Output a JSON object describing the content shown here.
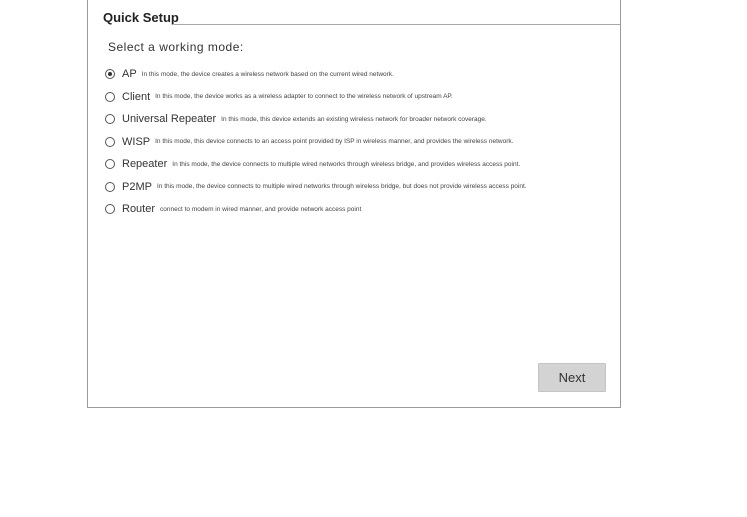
{
  "quick_setup": {
    "legend": "Quick Setup",
    "prompt": "Select a working mode:"
  },
  "modes": [
    {
      "name": "AP",
      "description": "In this mode, the device creates a wireless network based on the current wired network.",
      "selected": true
    },
    {
      "name": "Client",
      "description": "In this mode, the device works as a wireless adapter to connect to the wireless network of upstream AP.",
      "selected": false
    },
    {
      "name": "Universal Repeater",
      "description": "In this mode, this device extends an existing wireless network for broader network coverage.",
      "selected": false
    },
    {
      "name": "WISP",
      "description": "In this mode, this device connects to an access point provided by ISP in wireless manner, and provides the wireless network.",
      "selected": false
    },
    {
      "name": "Repeater",
      "description": "In this mode, the device connects to multiple wired networks through wireless bridge, and provides wireless access point.",
      "selected": false
    },
    {
      "name": "P2MP",
      "description": "In this mode, the device connects to multiple wired networks through wireless bridge, but does not provide wireless access point.",
      "selected": false
    },
    {
      "name": "Router",
      "description": "connect to modem in wired manner, and provide network access point",
      "selected": false
    }
  ],
  "actions": {
    "next_label": "Next"
  }
}
